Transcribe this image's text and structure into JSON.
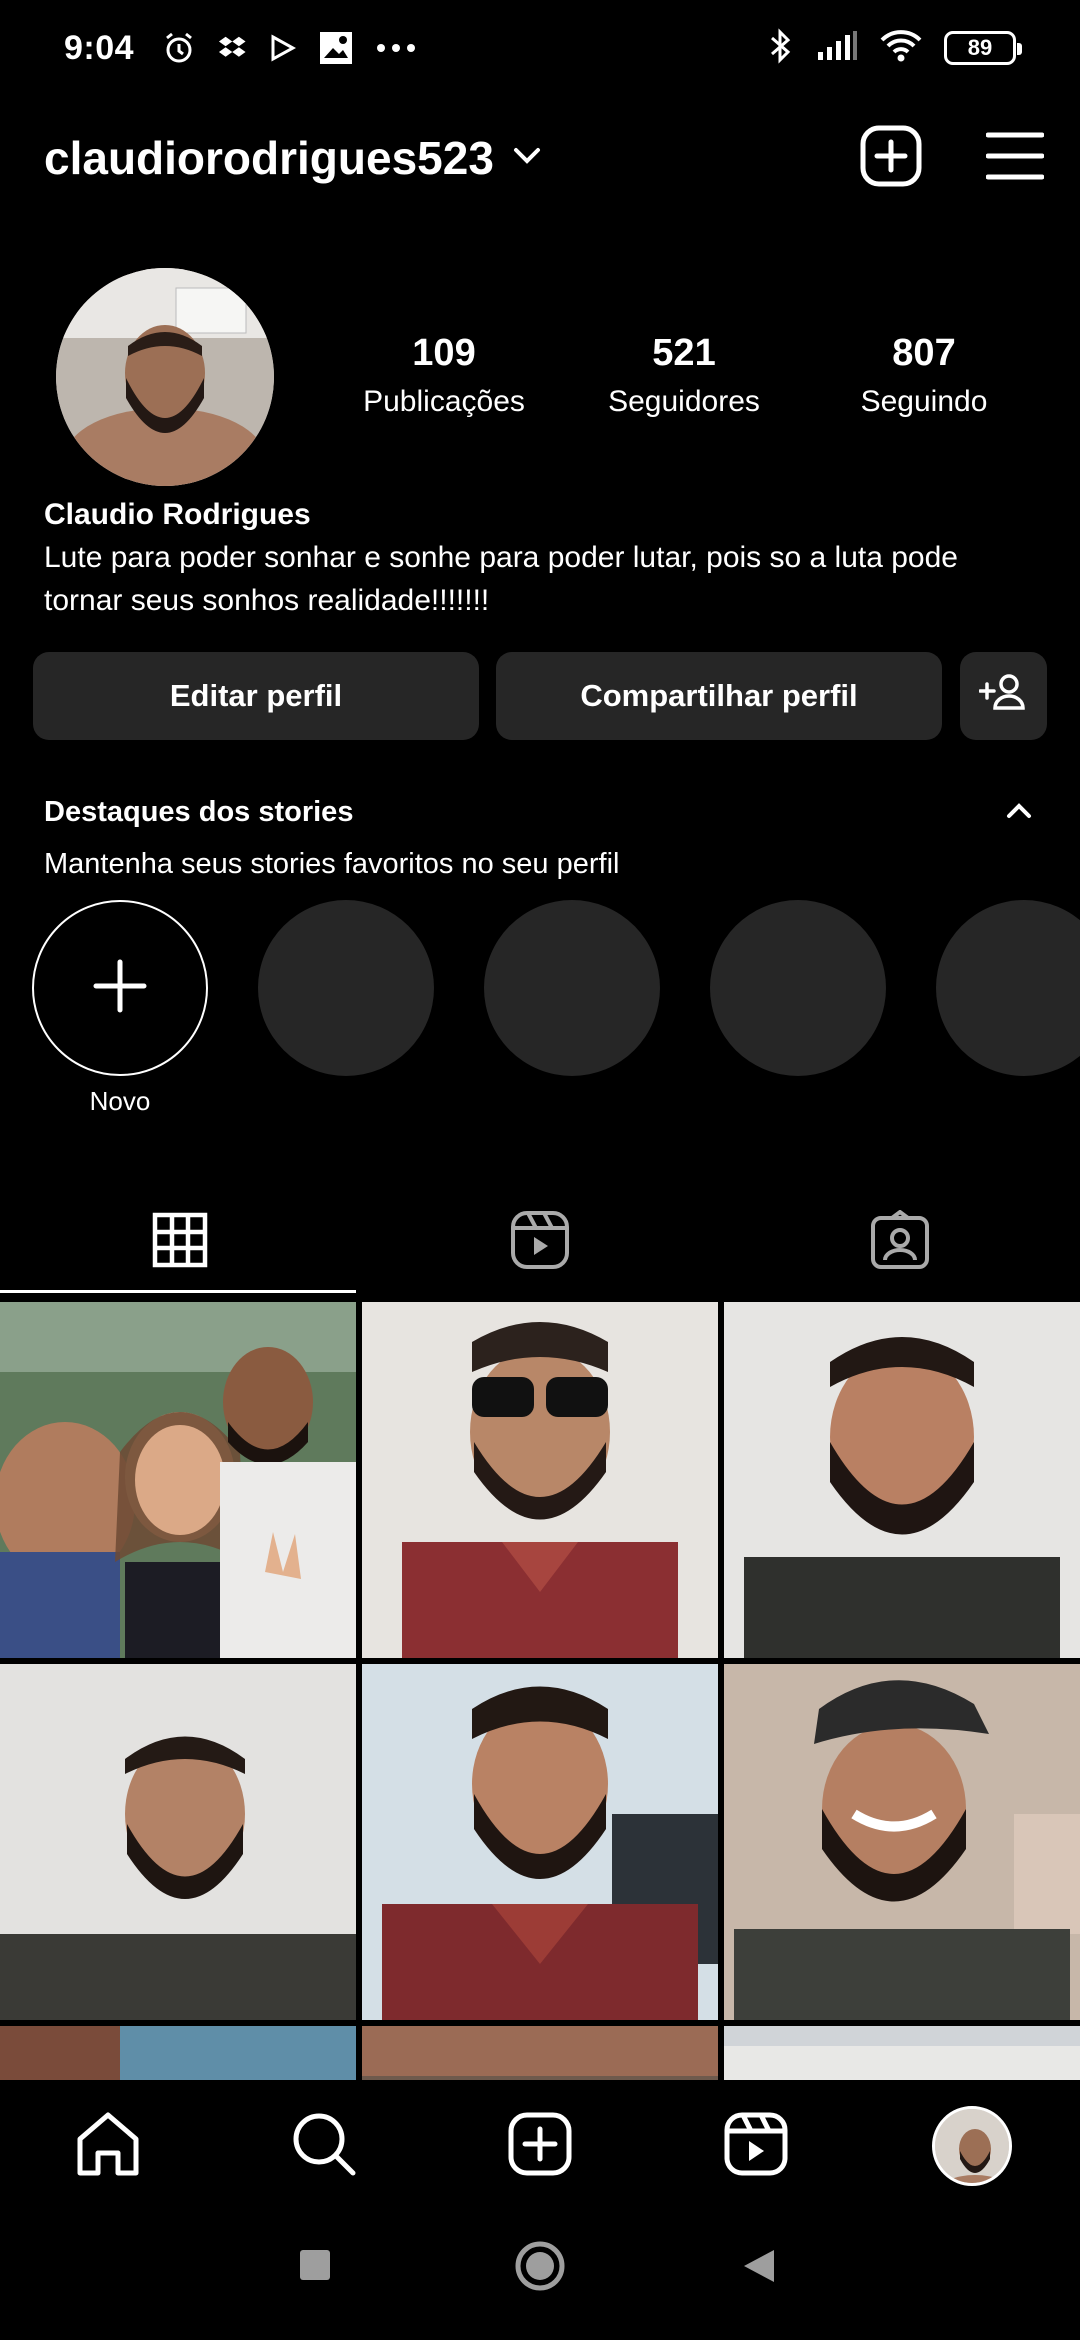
{
  "status_bar": {
    "time": "9:04",
    "battery": "89",
    "icons": [
      "alarm-icon",
      "dropbox-icon",
      "play-icon",
      "image-icon",
      "more-icon",
      "bluetooth-icon",
      "signal-icon",
      "wifi-icon"
    ]
  },
  "header": {
    "username": "claudiorodrigues523"
  },
  "profile": {
    "stats": [
      {
        "value": "109",
        "label": "Publicações"
      },
      {
        "value": "521",
        "label": "Seguidores"
      },
      {
        "value": "807",
        "label": "Seguindo"
      }
    ],
    "name": "Claudio Rodrigues",
    "bio": "Lute para poder sonhar e sonhe para poder lutar, pois so a luta pode tornar seus sonhos realidade!!!!!!!"
  },
  "buttons": {
    "edit": "Editar perfil",
    "share": "Compartilhar perfil"
  },
  "highlights": {
    "title": "Destaques dos stories",
    "subtitle": "Mantenha seus stories favoritos no seu perfil",
    "new_label": "Novo"
  },
  "tabs": [
    "grid-icon",
    "reels-icon",
    "tagged-icon"
  ],
  "bottom_nav": [
    "home-icon",
    "search-icon",
    "create-icon",
    "reels-icon",
    "profile-avatar"
  ],
  "colors": {
    "background": "#000000",
    "surface": "#262626",
    "text": "#ffffff"
  }
}
